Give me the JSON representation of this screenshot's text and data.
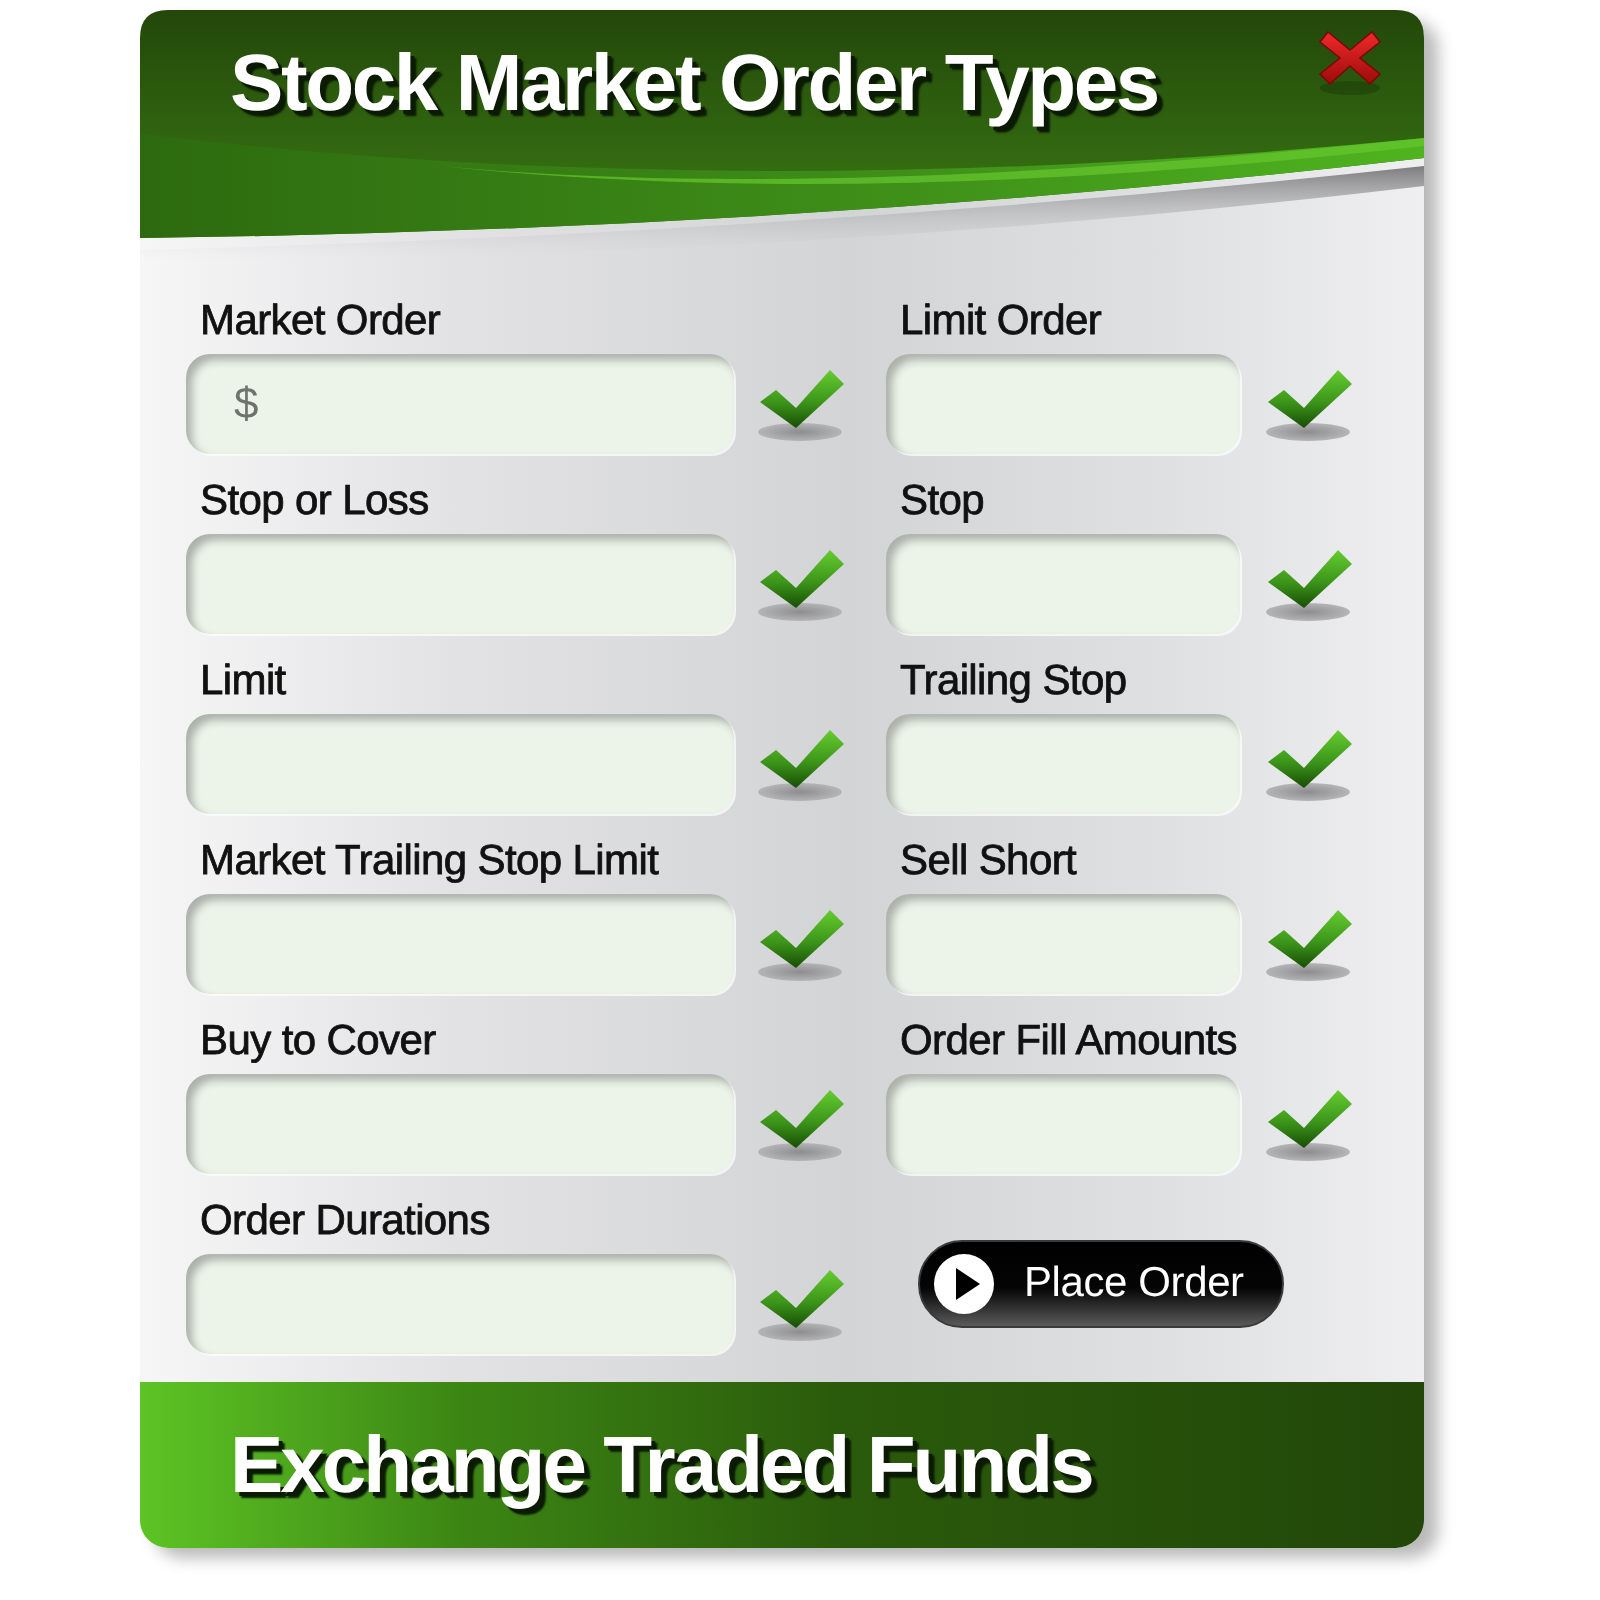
{
  "window": {
    "title": "Stock Market Order Types"
  },
  "fields": [
    {
      "label": "Market Order",
      "placeholder": "$",
      "checked": true
    },
    {
      "label": "Limit Order",
      "checked": true
    },
    {
      "label": "Stop or Loss",
      "checked": true
    },
    {
      "label": "Stop",
      "checked": true
    },
    {
      "label": "Limit",
      "checked": true
    },
    {
      "label": "Trailing Stop",
      "checked": true
    },
    {
      "label": "Market Trailing Stop Limit",
      "checked": true
    },
    {
      "label": "Sell Short",
      "checked": true
    },
    {
      "label": "Buy to Cover",
      "checked": true
    },
    {
      "label": "Order Fill Amounts",
      "checked": true
    },
    {
      "label": "Order Durations",
      "checked": true
    }
  ],
  "button": {
    "label": "Place Order"
  },
  "footer": {
    "title": "Exchange Traded Funds"
  }
}
